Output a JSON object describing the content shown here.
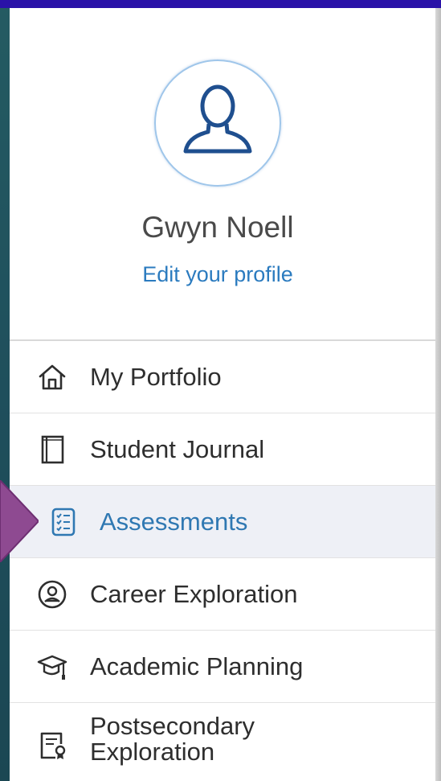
{
  "profile": {
    "name": "Gwyn Noell",
    "edit_link": "Edit your profile",
    "avatar_icon": "user-icon"
  },
  "nav": {
    "items": [
      {
        "label": "My Portfolio",
        "icon": "home-icon",
        "active": false
      },
      {
        "label": "Student Journal",
        "icon": "journal-icon",
        "active": false
      },
      {
        "label": "Assessments",
        "icon": "assessment-checklist-icon",
        "active": true
      },
      {
        "label": "Career Exploration",
        "icon": "person-circle-icon",
        "active": false
      },
      {
        "label": "Academic Planning",
        "icon": "graduation-cap-icon",
        "active": false
      },
      {
        "label": "Postsecondary Exploration",
        "line1": "Postsecondary",
        "line2": "Exploration",
        "icon": "certificate-icon",
        "active": false
      }
    ]
  },
  "colors": {
    "accent": "#2f78b2",
    "top_bar": "#2a12a8",
    "active_bg": "#eef0f6",
    "pointer": "#8e4a91",
    "background": "#245b62"
  }
}
